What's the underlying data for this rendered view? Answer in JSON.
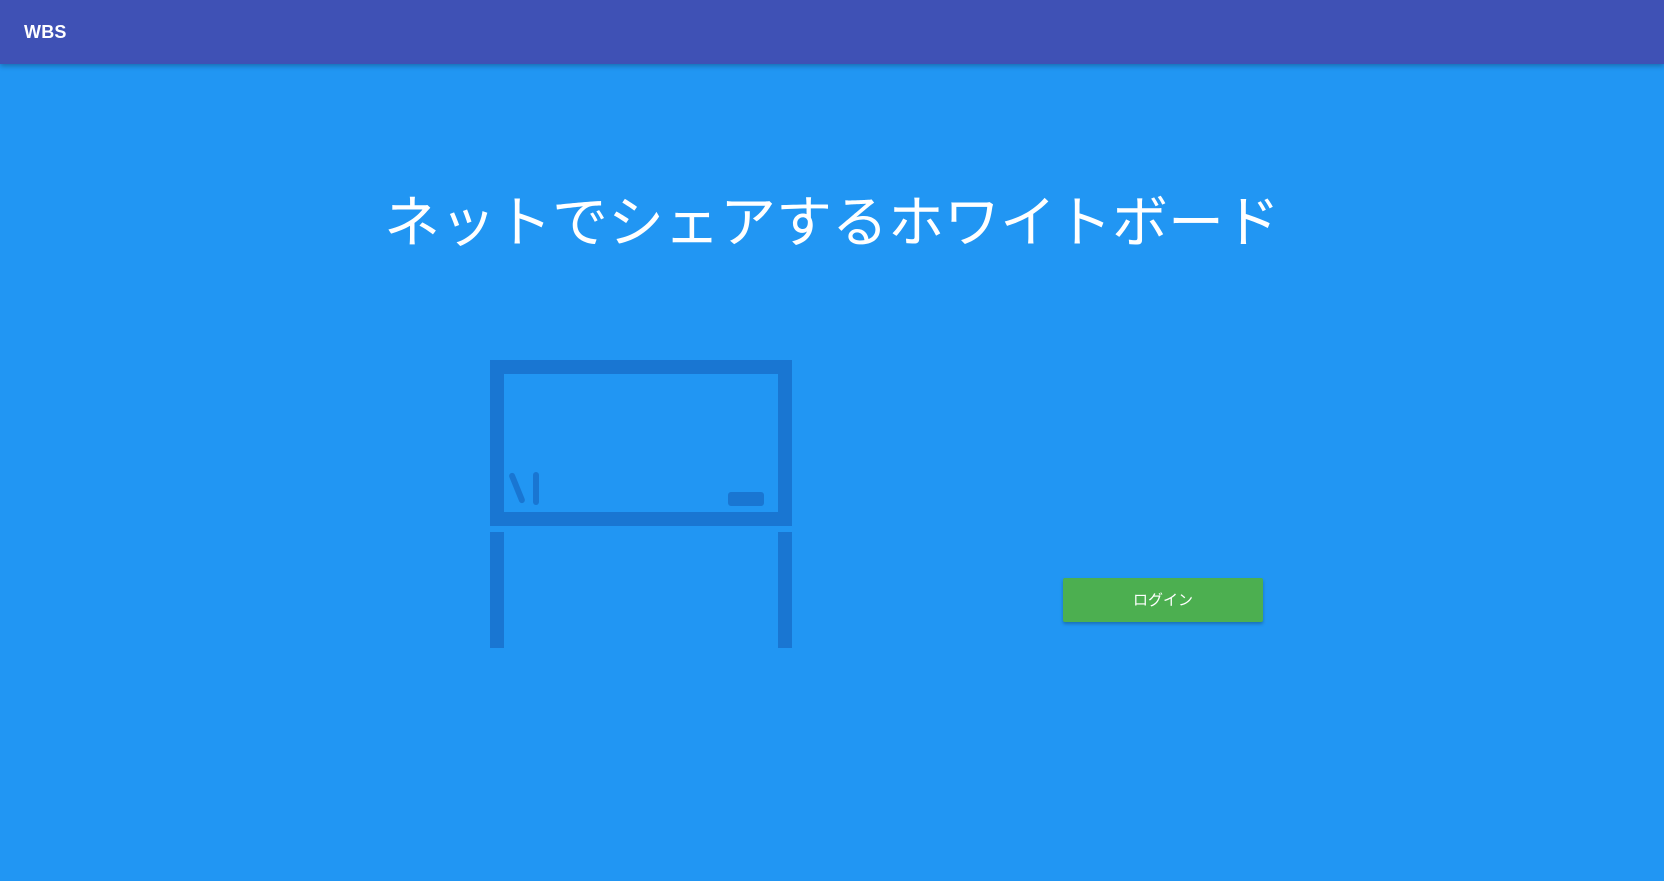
{
  "app_bar": {
    "title": "WBS",
    "background_color": "#3f51b5"
  },
  "hero": {
    "title": "ネットでシェアするホワイトボード",
    "background_color": "#2196f3"
  },
  "illustration": {
    "icon": "whiteboard-icon",
    "color": "#1976d2"
  },
  "login": {
    "label": "ログイン",
    "color": "#4caf50"
  }
}
